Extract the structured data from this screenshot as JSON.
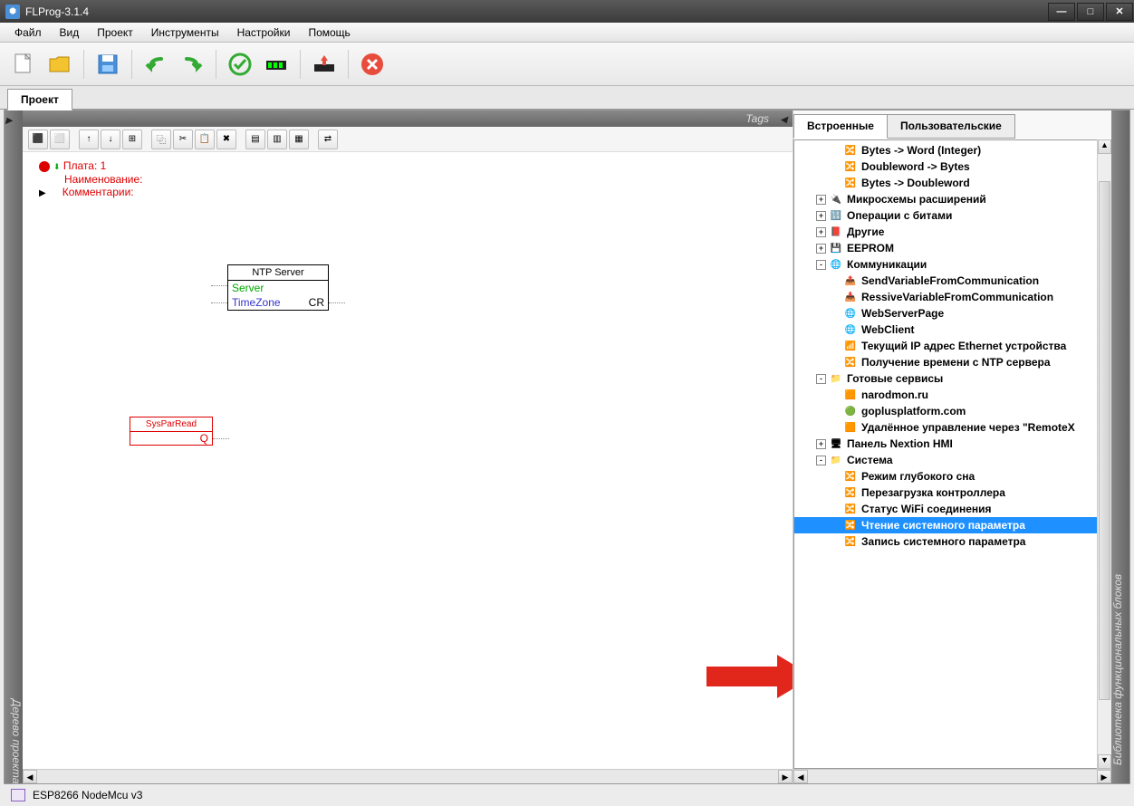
{
  "window": {
    "title": "FLProg-3.1.4"
  },
  "menu": {
    "file": "Файл",
    "view": "Вид",
    "project": "Проект",
    "tools": "Инструменты",
    "settings": "Настройки",
    "help": "Помощь"
  },
  "tab": {
    "project": "Проект"
  },
  "sidestrip": {
    "left": "Дерево проекта",
    "rightTop": "Tags",
    "right": "Библиотека функциональных блоков"
  },
  "canvas": {
    "board": "Плата: 1",
    "name": "Наименование:",
    "comments": "Комментарии:",
    "ntp_title": "NTP Server",
    "ntp_server": "Server",
    "ntp_tz": "TimeZone",
    "ntp_cr": "CR",
    "syspar": "SysParRead",
    "syspar_q": "Q"
  },
  "rtabs": {
    "builtin": "Встроенные",
    "user": "Пользовательские"
  },
  "tree": [
    {
      "lvl": 2,
      "exp": "",
      "ico": "🔀",
      "label": "Bytes -> Word (Integer)"
    },
    {
      "lvl": 2,
      "exp": "",
      "ico": "🔀",
      "label": "Doubleword -> Bytes"
    },
    {
      "lvl": 2,
      "exp": "",
      "ico": "🔀",
      "label": "Bytes -> Doubleword"
    },
    {
      "lvl": 1,
      "exp": "+",
      "ico": "🔌",
      "label": "Микросхемы расширений"
    },
    {
      "lvl": 1,
      "exp": "+",
      "ico": "🔢",
      "label": "Операции с битами"
    },
    {
      "lvl": 1,
      "exp": "+",
      "ico": "📕",
      "label": "Другие"
    },
    {
      "lvl": 1,
      "exp": "+",
      "ico": "💾",
      "label": "EEPROM"
    },
    {
      "lvl": 1,
      "exp": "-",
      "ico": "🌐",
      "label": "Коммуникации"
    },
    {
      "lvl": 2,
      "exp": "",
      "ico": "📤",
      "label": "SendVariableFromCommunication"
    },
    {
      "lvl": 2,
      "exp": "",
      "ico": "📥",
      "label": "RessiveVariableFromCommunication"
    },
    {
      "lvl": 2,
      "exp": "",
      "ico": "🌐",
      "label": "WebServerPage"
    },
    {
      "lvl": 2,
      "exp": "",
      "ico": "🌐",
      "label": "WebClient"
    },
    {
      "lvl": 2,
      "exp": "",
      "ico": "📶",
      "label": "Текущий IP адрес Ethernet устройства"
    },
    {
      "lvl": 2,
      "exp": "",
      "ico": "🔀",
      "label": "Получение времени с NTP сервера"
    },
    {
      "lvl": 1,
      "exp": "-",
      "ico": "📁",
      "label": "Готовые сервисы"
    },
    {
      "lvl": 2,
      "exp": "",
      "ico": "🟧",
      "label": "narodmon.ru"
    },
    {
      "lvl": 2,
      "exp": "",
      "ico": "🟢",
      "label": "goplusplatform.com"
    },
    {
      "lvl": 2,
      "exp": "",
      "ico": "🟧",
      "label": "Удалённое управление через \"RemoteX"
    },
    {
      "lvl": 1,
      "exp": "+",
      "ico": "🖥",
      "label": "Панель Nextion HMI"
    },
    {
      "lvl": 1,
      "exp": "-",
      "ico": "📁",
      "label": "Система"
    },
    {
      "lvl": 2,
      "exp": "",
      "ico": "🔀",
      "label": "Режим глубокого сна"
    },
    {
      "lvl": 2,
      "exp": "",
      "ico": "🔀",
      "label": "Перезагрузка контроллера"
    },
    {
      "lvl": 2,
      "exp": "",
      "ico": "🔀",
      "label": "Статус WiFi соединения"
    },
    {
      "lvl": 2,
      "exp": "",
      "ico": "🔀",
      "label": "Чтение системного параметра",
      "sel": true
    },
    {
      "lvl": 2,
      "exp": "",
      "ico": "🔀",
      "label": "Запись системного параметра"
    }
  ],
  "status": {
    "board": "ESP8266 NodeMcu v3"
  }
}
